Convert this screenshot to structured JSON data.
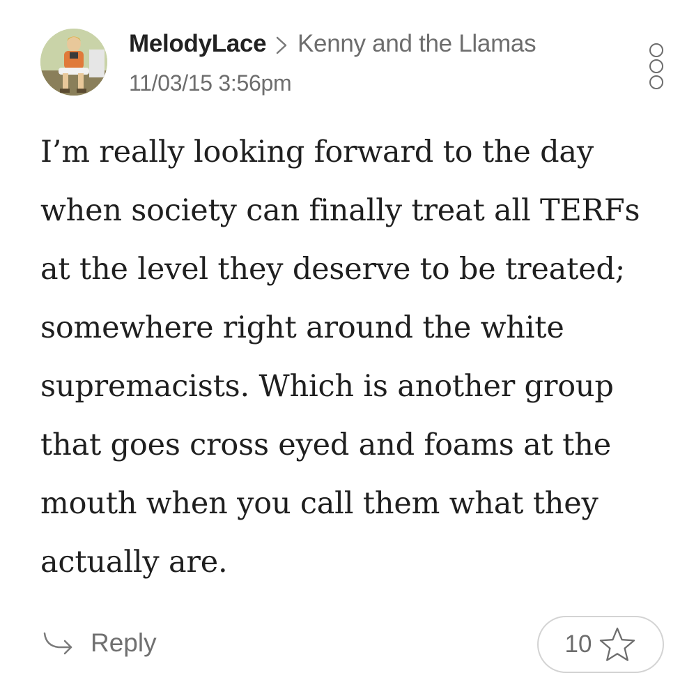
{
  "comment": {
    "author": "MelodyLace",
    "blog": "Kenny and the Llamas",
    "timestamp": "11/03/15 3:56pm",
    "text": "I’m really looking forward to the day when society can finally treat all TERFs at the level they deserve to be treated; somewhere right around the white supremacists. Which is another group that goes cross eyed and foams at the mouth when you call them what they actually are.",
    "text_lines": [
      "I’m really looking forward to the day",
      "when society can finally treat all TERFs",
      "at the level they deserve to be treated;",
      "somewhere right around the white",
      "supremacists. Which is another group",
      "that goes cross eyed and foams at the",
      "mouth when you call them what they",
      "actually are."
    ]
  },
  "actions": {
    "reply_label": "Reply",
    "star_count": "10"
  },
  "icons": {
    "separator": "chevron-right-icon",
    "more": "more-options-icon",
    "reply": "reply-arrow-icon",
    "star": "star-outline-icon"
  },
  "colors": {
    "primary_text": "#222222",
    "secondary_text": "#6d6d6d",
    "border": "#d3d3d3",
    "background": "#ffffff"
  }
}
